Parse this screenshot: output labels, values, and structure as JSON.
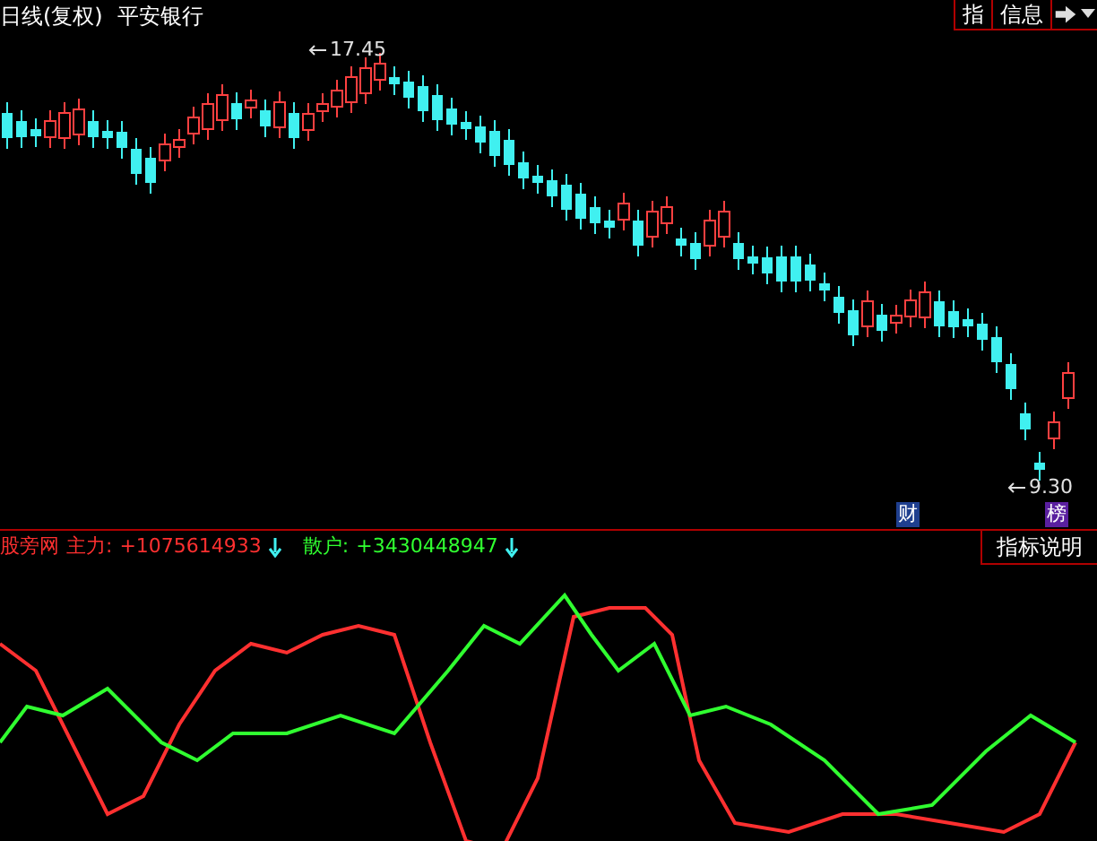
{
  "header": {
    "period": "日线(复权)",
    "stock": "平安银行"
  },
  "toolbar": [
    {
      "label": "指"
    },
    {
      "label": "信息"
    }
  ],
  "price_chart": {
    "high_label": "17.45",
    "low_label": "9.30",
    "badges": [
      {
        "label": "财",
        "color": "#1f3f8f"
      },
      {
        "label": "榜",
        "color": "#5a1f9f"
      }
    ]
  },
  "indicator": {
    "name": "股旁网",
    "series": [
      {
        "label": "主力:",
        "value": "+1075614933",
        "color": "#ff3030"
      },
      {
        "label": "散户:",
        "value": "+3430448947",
        "color": "#30ff30"
      }
    ],
    "help_button": "指标说明"
  }
}
